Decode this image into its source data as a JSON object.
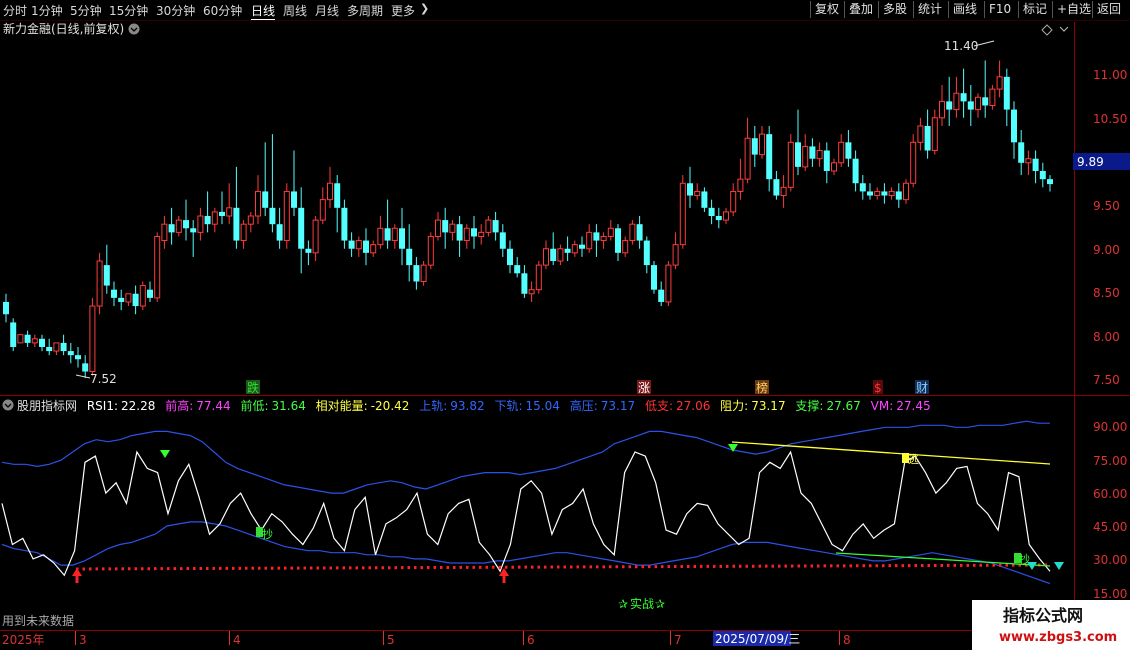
{
  "period_tabs": [
    "分时",
    "1分钟",
    "5分钟",
    "15分钟",
    "30分钟",
    "60分钟",
    "日线",
    "周线",
    "月线",
    "多周期",
    "更多"
  ],
  "active_period": "日线",
  "more_chevron": "chevron-right-icon",
  "toolbar": [
    "复权",
    "叠加",
    "多股",
    "统计",
    "画线",
    "F10",
    "标记",
    "+自选",
    "返回"
  ],
  "stock": {
    "name": "新力金融",
    "mode": "(日线,前复权)"
  },
  "price_panel": {
    "y_ticks": [
      "11.00",
      "10.50",
      "10.00",
      "9.50",
      "9.00",
      "8.50",
      "8.00",
      "7.50"
    ],
    "current_price": "9.89",
    "high_label": "11.40",
    "low_label": "7.52",
    "markers": [
      {
        "text": "跌",
        "color": "#33dd33",
        "box": "#1a5a1a"
      },
      {
        "text": "涨",
        "color": "#ffffff",
        "box": "#7a1a1a"
      },
      {
        "text": "榜",
        "color": "#ffcc66",
        "box": "#6a3a10"
      },
      {
        "text": "$",
        "color": "#ff3333",
        "box": "#5a0a0a"
      },
      {
        "text": "财",
        "color": "#88ccff",
        "box": "#10305a"
      }
    ]
  },
  "indicator": {
    "name": "股朋指标网",
    "items": [
      {
        "label": "RSI1:",
        "value": "22.28",
        "color": "#ffffff"
      },
      {
        "label": "前高:",
        "value": "77.44",
        "color": "#ff44ff"
      },
      {
        "label": "前低:",
        "value": "31.64",
        "color": "#44ff44"
      },
      {
        "label": "相对能量:",
        "value": "-20.42",
        "color": "#ffff44"
      },
      {
        "label": "上轨:",
        "value": "93.82",
        "color": "#3366ff"
      },
      {
        "label": "下轨:",
        "value": "15.04",
        "color": "#3366ff"
      },
      {
        "label": "高压:",
        "value": "73.17",
        "color": "#3366ff"
      },
      {
        "label": "低支:",
        "value": "27.06",
        "color": "#ff3333"
      },
      {
        "label": "阻力:",
        "value": "73.17",
        "color": "#ffff44"
      },
      {
        "label": "支撑:",
        "value": "27.67",
        "color": "#44ff44"
      },
      {
        "label": "VM:",
        "value": "27.45",
        "color": "#ff44ff"
      }
    ],
    "y_ticks": [
      "90.00",
      "75.00",
      "60.00",
      "45.00",
      "30.00",
      "15.00"
    ],
    "signals": [
      "抄",
      "抄",
      "逃",
      "抄"
    ],
    "center_label": "实战",
    "future_data_note": "用到未来数据"
  },
  "date_axis": {
    "labels": [
      "2025年",
      "3",
      "4",
      "5",
      "6",
      "7",
      "8"
    ],
    "cursor_date": "2025/07/09/三"
  },
  "watermark": {
    "title": "指标公式网",
    "url": "www.zbgs3.com"
  },
  "chart_data": {
    "type": "candlestick",
    "title": "新力金融(日线,前复权)",
    "y_range": [
      7.35,
      11.65
    ],
    "candles": [
      [
        8.45,
        8.55,
        8.3,
        8.2
      ],
      [
        8.2,
        8.25,
        7.9,
        7.85
      ],
      [
        7.95,
        8.05,
        8.05,
        7.95
      ],
      [
        8.05,
        8.1,
        7.95,
        7.9
      ],
      [
        7.95,
        8.05,
        8.0,
        7.9
      ],
      [
        8.0,
        8.05,
        7.9,
        7.85
      ],
      [
        7.9,
        8.0,
        7.85,
        7.8
      ],
      [
        7.85,
        7.95,
        7.95,
        7.8
      ],
      [
        7.95,
        8.05,
        7.85,
        7.8
      ],
      [
        7.85,
        7.95,
        7.8,
        7.7
      ],
      [
        7.8,
        7.9,
        7.75,
        7.65
      ],
      [
        7.7,
        7.8,
        7.6,
        7.52
      ],
      [
        7.6,
        8.5,
        8.4,
        7.55
      ],
      [
        8.4,
        9.05,
        8.95,
        8.3
      ],
      [
        8.9,
        9.15,
        8.65,
        8.55
      ],
      [
        8.6,
        8.7,
        8.5,
        8.4
      ],
      [
        8.5,
        8.6,
        8.45,
        8.35
      ],
      [
        8.45,
        8.55,
        8.55,
        8.4
      ],
      [
        8.55,
        8.65,
        8.4,
        8.3
      ],
      [
        8.4,
        8.7,
        8.65,
        8.35
      ],
      [
        8.6,
        8.7,
        8.5,
        8.45
      ],
      [
        8.5,
        9.3,
        9.25,
        8.45
      ],
      [
        9.2,
        9.5,
        9.4,
        9.1
      ],
      [
        9.4,
        9.6,
        9.3,
        9.15
      ],
      [
        9.3,
        9.5,
        9.45,
        9.25
      ],
      [
        9.45,
        9.7,
        9.35,
        9.2
      ],
      [
        9.35,
        9.45,
        9.3,
        9.0
      ],
      [
        9.3,
        9.6,
        9.5,
        9.2
      ],
      [
        9.5,
        9.8,
        9.4,
        9.3
      ],
      [
        9.4,
        9.6,
        9.55,
        9.3
      ],
      [
        9.55,
        9.8,
        9.5,
        9.4
      ],
      [
        9.5,
        9.9,
        9.6,
        9.4
      ],
      [
        9.6,
        10.1,
        9.2,
        9.1
      ],
      [
        9.2,
        9.45,
        9.4,
        9.1
      ],
      [
        9.4,
        9.55,
        9.5,
        9.3
      ],
      [
        9.5,
        10.0,
        9.8,
        9.4
      ],
      [
        9.8,
        10.4,
        9.6,
        9.5
      ],
      [
        9.6,
        10.5,
        9.4,
        9.3
      ],
      [
        9.4,
        9.6,
        9.2,
        9.1
      ],
      [
        9.2,
        9.9,
        9.8,
        9.1
      ],
      [
        9.8,
        10.3,
        9.6,
        9.5
      ],
      [
        9.6,
        9.85,
        9.1,
        8.8
      ],
      [
        9.1,
        9.2,
        9.05,
        8.9
      ],
      [
        9.05,
        9.5,
        9.45,
        8.95
      ],
      [
        9.45,
        9.85,
        9.7,
        9.4
      ],
      [
        9.7,
        10.1,
        9.9,
        9.6
      ],
      [
        9.9,
        10.0,
        9.6,
        9.3
      ],
      [
        9.6,
        9.7,
        9.2,
        9.1
      ],
      [
        9.2,
        9.3,
        9.1,
        9.0
      ],
      [
        9.1,
        9.25,
        9.2,
        9.0
      ],
      [
        9.2,
        9.35,
        9.05,
        8.9
      ],
      [
        9.05,
        9.2,
        9.15,
        9.0
      ],
      [
        9.15,
        9.5,
        9.35,
        9.1
      ],
      [
        9.35,
        9.7,
        9.2,
        9.1
      ],
      [
        9.2,
        9.4,
        9.35,
        9.1
      ],
      [
        9.35,
        9.6,
        9.1,
        8.9
      ],
      [
        9.1,
        9.4,
        8.9,
        8.7
      ],
      [
        8.9,
        9.0,
        8.7,
        8.6
      ],
      [
        8.7,
        8.95,
        8.9,
        8.65
      ],
      [
        8.9,
        9.3,
        9.25,
        8.85
      ],
      [
        9.25,
        9.55,
        9.45,
        9.2
      ],
      [
        9.45,
        9.6,
        9.3,
        9.1
      ],
      [
        9.3,
        9.45,
        9.4,
        9.2
      ],
      [
        9.4,
        9.5,
        9.2,
        9.0
      ],
      [
        9.2,
        9.4,
        9.35,
        9.1
      ],
      [
        9.35,
        9.5,
        9.25,
        9.1
      ],
      [
        9.25,
        9.4,
        9.3,
        9.15
      ],
      [
        9.3,
        9.5,
        9.45,
        9.25
      ],
      [
        9.45,
        9.55,
        9.3,
        9.2
      ],
      [
        9.3,
        9.4,
        9.1,
        9.0
      ],
      [
        9.1,
        9.2,
        8.9,
        8.8
      ],
      [
        8.9,
        9.0,
        8.8,
        8.75
      ],
      [
        8.8,
        8.9,
        8.55,
        8.5
      ],
      [
        8.55,
        8.7,
        8.6,
        8.45
      ],
      [
        8.6,
        8.95,
        8.9,
        8.55
      ],
      [
        8.9,
        9.2,
        9.1,
        8.85
      ],
      [
        9.1,
        9.3,
        8.95,
        8.9
      ],
      [
        8.95,
        9.15,
        9.1,
        8.9
      ],
      [
        9.1,
        9.25,
        9.05,
        8.95
      ],
      [
        9.05,
        9.2,
        9.15,
        9.0
      ],
      [
        9.15,
        9.25,
        9.1,
        9.0
      ],
      [
        9.1,
        9.4,
        9.3,
        9.05
      ],
      [
        9.3,
        9.4,
        9.2,
        9.0
      ],
      [
        9.2,
        9.3,
        9.25,
        9.1
      ],
      [
        9.25,
        9.45,
        9.35,
        9.2
      ],
      [
        9.35,
        9.4,
        9.05,
        8.95
      ],
      [
        9.05,
        9.25,
        9.2,
        9.0
      ],
      [
        9.2,
        9.45,
        9.4,
        9.15
      ],
      [
        9.4,
        9.5,
        9.2,
        9.1
      ],
      [
        9.2,
        9.25,
        8.9,
        8.8
      ],
      [
        8.9,
        8.95,
        8.6,
        8.55
      ],
      [
        8.6,
        8.7,
        8.45,
        8.4
      ],
      [
        8.45,
        8.95,
        8.9,
        8.4
      ],
      [
        8.9,
        9.3,
        9.15,
        8.85
      ],
      [
        9.15,
        10.0,
        9.9,
        9.1
      ],
      [
        9.9,
        10.1,
        9.75,
        9.6
      ],
      [
        9.75,
        9.9,
        9.8,
        9.7
      ],
      [
        9.8,
        9.85,
        9.6,
        9.55
      ],
      [
        9.6,
        9.7,
        9.5,
        9.4
      ],
      [
        9.5,
        9.6,
        9.45,
        9.35
      ],
      [
        9.45,
        9.6,
        9.55,
        9.4
      ],
      [
        9.55,
        9.9,
        9.8,
        9.5
      ],
      [
        9.8,
        10.2,
        9.95,
        9.7
      ],
      [
        9.95,
        10.7,
        10.45,
        9.9
      ],
      [
        10.45,
        10.6,
        10.25,
        10.1
      ],
      [
        10.25,
        10.6,
        10.5,
        10.2
      ],
      [
        10.5,
        10.6,
        9.95,
        9.8
      ],
      [
        9.95,
        10.05,
        9.75,
        9.7
      ],
      [
        9.75,
        10.0,
        9.85,
        9.6
      ],
      [
        9.85,
        10.5,
        10.4,
        9.8
      ],
      [
        10.4,
        10.8,
        10.1,
        10.0
      ],
      [
        10.1,
        10.5,
        10.35,
        10.05
      ],
      [
        10.35,
        10.45,
        10.2,
        10.1
      ],
      [
        10.2,
        10.4,
        10.3,
        10.1
      ],
      [
        10.3,
        10.4,
        10.05,
        9.9
      ],
      [
        10.05,
        10.2,
        10.15,
        10.0
      ],
      [
        10.15,
        10.5,
        10.4,
        10.1
      ],
      [
        10.4,
        10.55,
        10.2,
        10.1
      ],
      [
        10.2,
        10.3,
        9.9,
        9.8
      ],
      [
        9.9,
        10.0,
        9.8,
        9.7
      ],
      [
        9.8,
        9.9,
        9.75,
        9.7
      ],
      [
        9.75,
        9.85,
        9.8,
        9.7
      ],
      [
        9.8,
        9.9,
        9.75,
        9.65
      ],
      [
        9.75,
        9.85,
        9.8,
        9.7
      ],
      [
        9.8,
        9.9,
        9.7,
        9.6
      ],
      [
        9.7,
        9.95,
        9.9,
        9.65
      ],
      [
        9.9,
        10.5,
        10.4,
        9.85
      ],
      [
        10.4,
        10.7,
        10.6,
        10.3
      ],
      [
        10.6,
        10.8,
        10.3,
        10.2
      ],
      [
        10.3,
        10.8,
        10.7,
        10.25
      ],
      [
        10.7,
        11.1,
        10.9,
        10.6
      ],
      [
        10.9,
        11.2,
        10.8,
        10.6
      ],
      [
        10.8,
        11.2,
        11.0,
        10.7
      ],
      [
        11.0,
        11.3,
        10.9,
        10.7
      ],
      [
        10.9,
        11.1,
        10.8,
        10.6
      ],
      [
        10.8,
        11.0,
        10.95,
        10.7
      ],
      [
        10.95,
        11.4,
        10.85,
        10.7
      ],
      [
        10.85,
        11.1,
        11.05,
        10.8
      ],
      [
        11.05,
        11.4,
        11.2,
        10.95
      ],
      [
        11.2,
        11.3,
        10.8,
        10.6
      ],
      [
        10.8,
        10.9,
        10.4,
        10.2
      ],
      [
        10.4,
        10.55,
        10.15,
        10.0
      ],
      [
        10.15,
        10.3,
        10.2,
        10.0
      ],
      [
        10.2,
        10.3,
        10.05,
        9.9
      ],
      [
        10.05,
        10.15,
        9.95,
        9.85
      ],
      [
        9.95,
        10.0,
        9.89,
        9.8
      ]
    ],
    "rsi1": [
      55,
      35,
      38,
      28,
      30,
      26,
      20,
      32,
      75,
      78,
      60,
      65,
      55,
      80,
      72,
      70,
      50,
      66,
      74,
      58,
      40,
      45,
      55,
      60,
      50,
      42,
      50,
      46,
      40,
      35,
      43,
      55,
      38,
      32,
      52,
      58,
      30,
      45,
      48,
      52,
      60,
      40,
      35,
      50,
      55,
      57,
      36,
      30,
      22,
      35,
      62,
      66,
      60,
      40,
      52,
      55,
      62,
      45,
      35,
      30,
      70,
      80,
      78,
      65,
      42,
      40,
      50,
      55,
      54,
      45,
      40,
      35,
      38,
      70,
      75,
      72,
      80,
      60,
      55,
      45,
      35,
      32,
      40,
      45,
      38,
      42,
      45,
      75,
      78,
      70,
      60,
      65,
      72,
      73,
      55,
      50,
      42,
      70,
      68,
      35,
      28,
      22
    ],
    "upper_band": [
      75,
      74,
      74,
      73,
      74,
      76,
      80,
      84,
      86,
      85,
      86,
      88,
      89,
      90,
      90,
      89,
      88,
      85,
      80,
      75,
      72,
      70,
      68,
      66,
      64,
      63,
      62,
      61,
      60,
      60,
      62,
      64,
      65,
      66,
      65,
      63,
      62,
      64,
      66,
      68,
      69,
      70,
      70,
      70,
      69,
      70,
      71,
      72,
      74,
      76,
      78,
      80,
      84,
      86,
      88,
      90,
      90,
      89,
      88,
      87,
      85,
      83,
      81,
      80,
      79,
      80,
      82,
      84,
      85,
      86,
      87,
      88,
      89,
      90,
      91,
      92,
      92,
      92,
      93,
      93,
      93,
      92,
      92,
      93,
      93,
      93,
      94,
      95,
      94,
      94
    ],
    "lower_band": [
      35,
      33,
      32,
      31,
      28,
      25,
      25,
      27,
      30,
      33,
      35,
      36,
      38,
      40,
      44,
      45,
      46,
      46,
      45,
      44,
      42,
      40,
      38,
      36,
      34,
      33,
      32,
      32,
      31,
      31,
      31,
      30,
      30,
      29,
      29,
      28,
      28,
      27,
      26,
      26,
      26,
      26,
      27,
      27,
      28,
      29,
      30,
      31,
      31,
      30,
      29,
      28,
      27,
      26,
      25,
      25,
      26,
      27,
      28,
      29,
      31,
      33,
      35,
      36,
      36,
      36,
      35,
      34,
      33,
      32,
      31,
      30,
      29,
      28,
      27,
      27,
      28,
      29,
      30,
      31,
      30,
      29,
      28,
      27,
      26,
      24,
      22,
      20,
      18,
      16
    ]
  }
}
